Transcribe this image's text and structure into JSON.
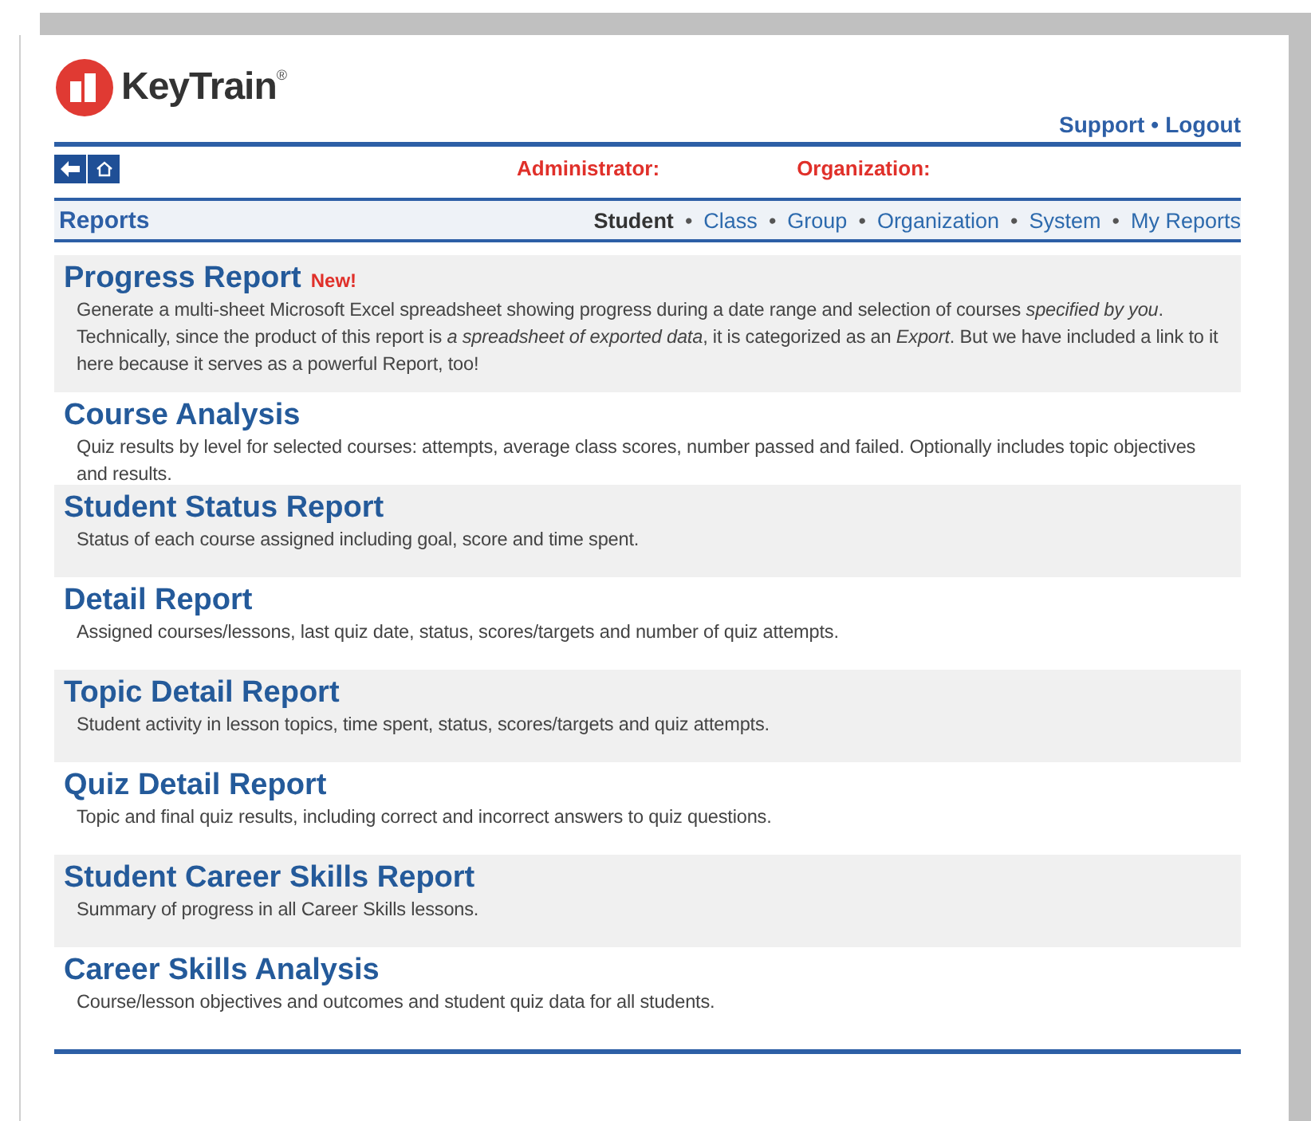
{
  "logo": {
    "name": "KeyTrain",
    "mark": "®"
  },
  "header_links": [
    {
      "label": "Support"
    },
    {
      "separator": "•",
      "label": "Logout"
    }
  ],
  "toolbar": {
    "fields": [
      {
        "label": "Administrator:"
      },
      {
        "label": "Organization:"
      }
    ]
  },
  "section": {
    "title": "Reports"
  },
  "nav": [
    {
      "label": "Student",
      "selected": true
    },
    {
      "separator": "•",
      "label": "Class",
      "selected": false
    },
    {
      "separator": "•",
      "label": "Group",
      "selected": false
    },
    {
      "separator": "•",
      "label": "Organization",
      "selected": false
    },
    {
      "separator": "•",
      "label": "System",
      "selected": false
    },
    {
      "separator": "•",
      "label": "My Reports",
      "selected": false
    }
  ],
  "reports": [
    {
      "title": "Progress Report",
      "badge": "New!",
      "description": "Generate a multi-sheet Microsoft Excel spreadsheet showing progress during a date range and selection of courses *specified by you*. Technically, since the product of this report is *a spreadsheet of exported data*, it is categorized as an *Export*. But we have included a link to it here because it serves as a powerful Report, too!"
    },
    {
      "title": "Course Analysis",
      "description": "Quiz results by level for selected courses: attempts, average class scores, number passed and failed. Optionally includes topic objectives and results."
    },
    {
      "title": "Student Status Report",
      "description": "Status of each course assigned including goal, score and time spent."
    },
    {
      "title": "Detail Report",
      "description": "Assigned courses/lessons, last quiz date, status, scores/targets and number of quiz attempts."
    },
    {
      "title": "Topic Detail Report",
      "description": "Student activity in lesson topics, time spent, status, scores/targets and quiz attempts."
    },
    {
      "title": "Quiz Detail Report",
      "description": "Topic and final quiz results, including correct and incorrect answers to quiz questions."
    },
    {
      "title": "Student Career Skills Report",
      "description": "Summary of progress in all Career Skills lessons."
    },
    {
      "title": "Career Skills Analysis",
      "description": "Course/lesson objectives and outcomes and student quiz data for all students."
    }
  ]
}
